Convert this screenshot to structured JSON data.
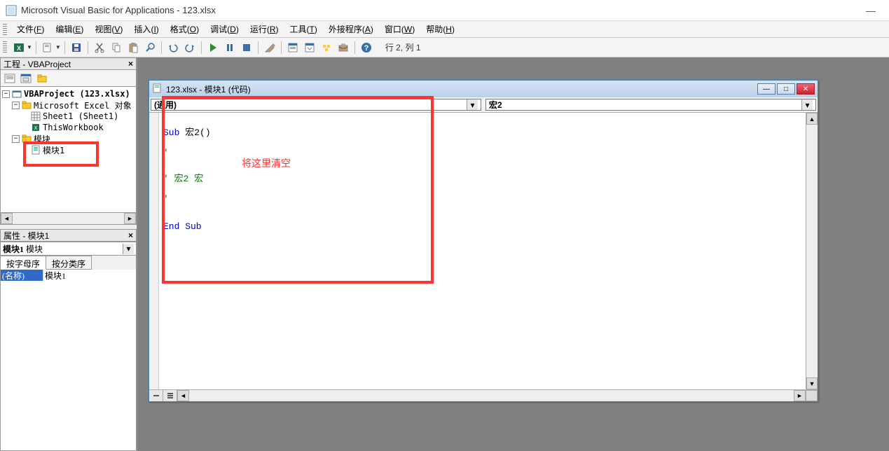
{
  "window": {
    "title": "Microsoft Visual Basic for Applications - 123.xlsx"
  },
  "menu": {
    "items": [
      {
        "label": "文件",
        "key": "F"
      },
      {
        "label": "编辑",
        "key": "E"
      },
      {
        "label": "视图",
        "key": "V"
      },
      {
        "label": "插入",
        "key": "I"
      },
      {
        "label": "格式",
        "key": "O"
      },
      {
        "label": "调试",
        "key": "D"
      },
      {
        "label": "运行",
        "key": "R"
      },
      {
        "label": "工具",
        "key": "T"
      },
      {
        "label": "外接程序",
        "key": "A"
      },
      {
        "label": "窗口",
        "key": "W"
      },
      {
        "label": "帮助",
        "key": "H"
      }
    ]
  },
  "toolbar": {
    "cursor_status": "行 2, 列 1"
  },
  "project_explorer": {
    "title": "工程 - VBAProject",
    "root": "VBAProject (123.xlsx)",
    "excel_objects_folder": "Microsoft Excel 对象",
    "sheet1": "Sheet1 (Sheet1)",
    "this_workbook": "ThisWorkbook",
    "modules_folder": "模块",
    "module1": "模块1"
  },
  "properties": {
    "title": "属性 - 模块1",
    "object_name": "模块1",
    "object_type": "模块",
    "tab_alpha": "按字母序",
    "tab_category": "按分类序",
    "row_name_key": "(名称)",
    "row_name_val": "模块1"
  },
  "code_window": {
    "title": "123.xlsx - 模块1 (代码)",
    "left_combo": "(通用)",
    "right_combo": "宏2",
    "code": {
      "l1_a": "Sub ",
      "l1_b": "宏2()",
      "l2": "'",
      "l3": "' 宏2 宏",
      "l4": "'",
      "l5_a": "End Sub"
    }
  },
  "annotation": {
    "text": "将这里清空"
  }
}
